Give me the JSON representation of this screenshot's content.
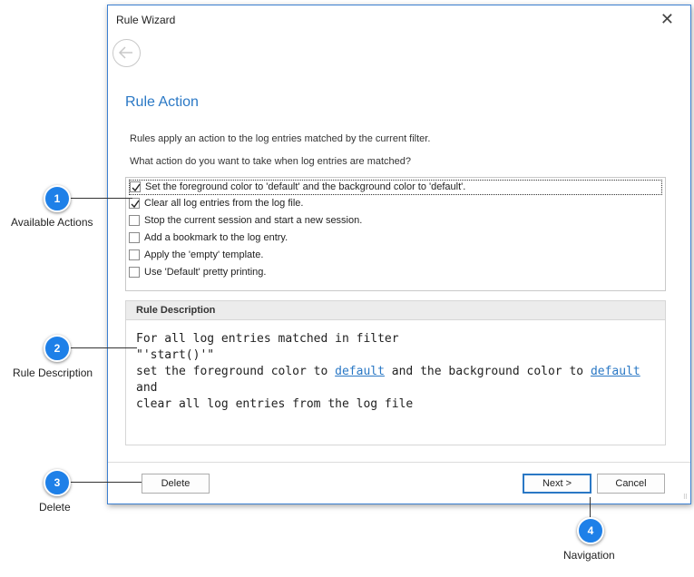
{
  "dialog": {
    "title": "Rule Wizard",
    "heading": "Rule Action",
    "intro": "Rules apply an action to the log entries matched by the current filter.",
    "question": "What action do you want to take when log entries are matched?",
    "actions": [
      {
        "label": "Set the foreground color to 'default' and the background color to 'default'.",
        "checked": true
      },
      {
        "label": "Clear all log entries from the log file.",
        "checked": true
      },
      {
        "label": "Stop the current session and start a new session.",
        "checked": false
      },
      {
        "label": "Add a bookmark to the log entry.",
        "checked": false
      },
      {
        "label": "Apply the 'empty' template.",
        "checked": false
      },
      {
        "label": "Use 'Default' pretty printing.",
        "checked": false
      }
    ],
    "description": {
      "header": "Rule Description",
      "line1": "For all log entries matched in filter",
      "line2": "\"'start()'\"",
      "line3_a": "set the foreground color to ",
      "link1": "default",
      "line3_b": " and the background color to ",
      "link2": "default",
      "line4": "and",
      "line5": "clear all log entries from the log file"
    },
    "buttons": {
      "delete": "Delete",
      "next": "Next >",
      "cancel": "Cancel"
    }
  },
  "callouts": [
    {
      "number": "1",
      "label": "Available Actions"
    },
    {
      "number": "2",
      "label": "Rule Description"
    },
    {
      "number": "3",
      "label": "Delete"
    },
    {
      "number": "4",
      "label": "Navigation"
    }
  ],
  "colors": {
    "accent": "#2a78c5",
    "callout": "#1e80e8"
  }
}
